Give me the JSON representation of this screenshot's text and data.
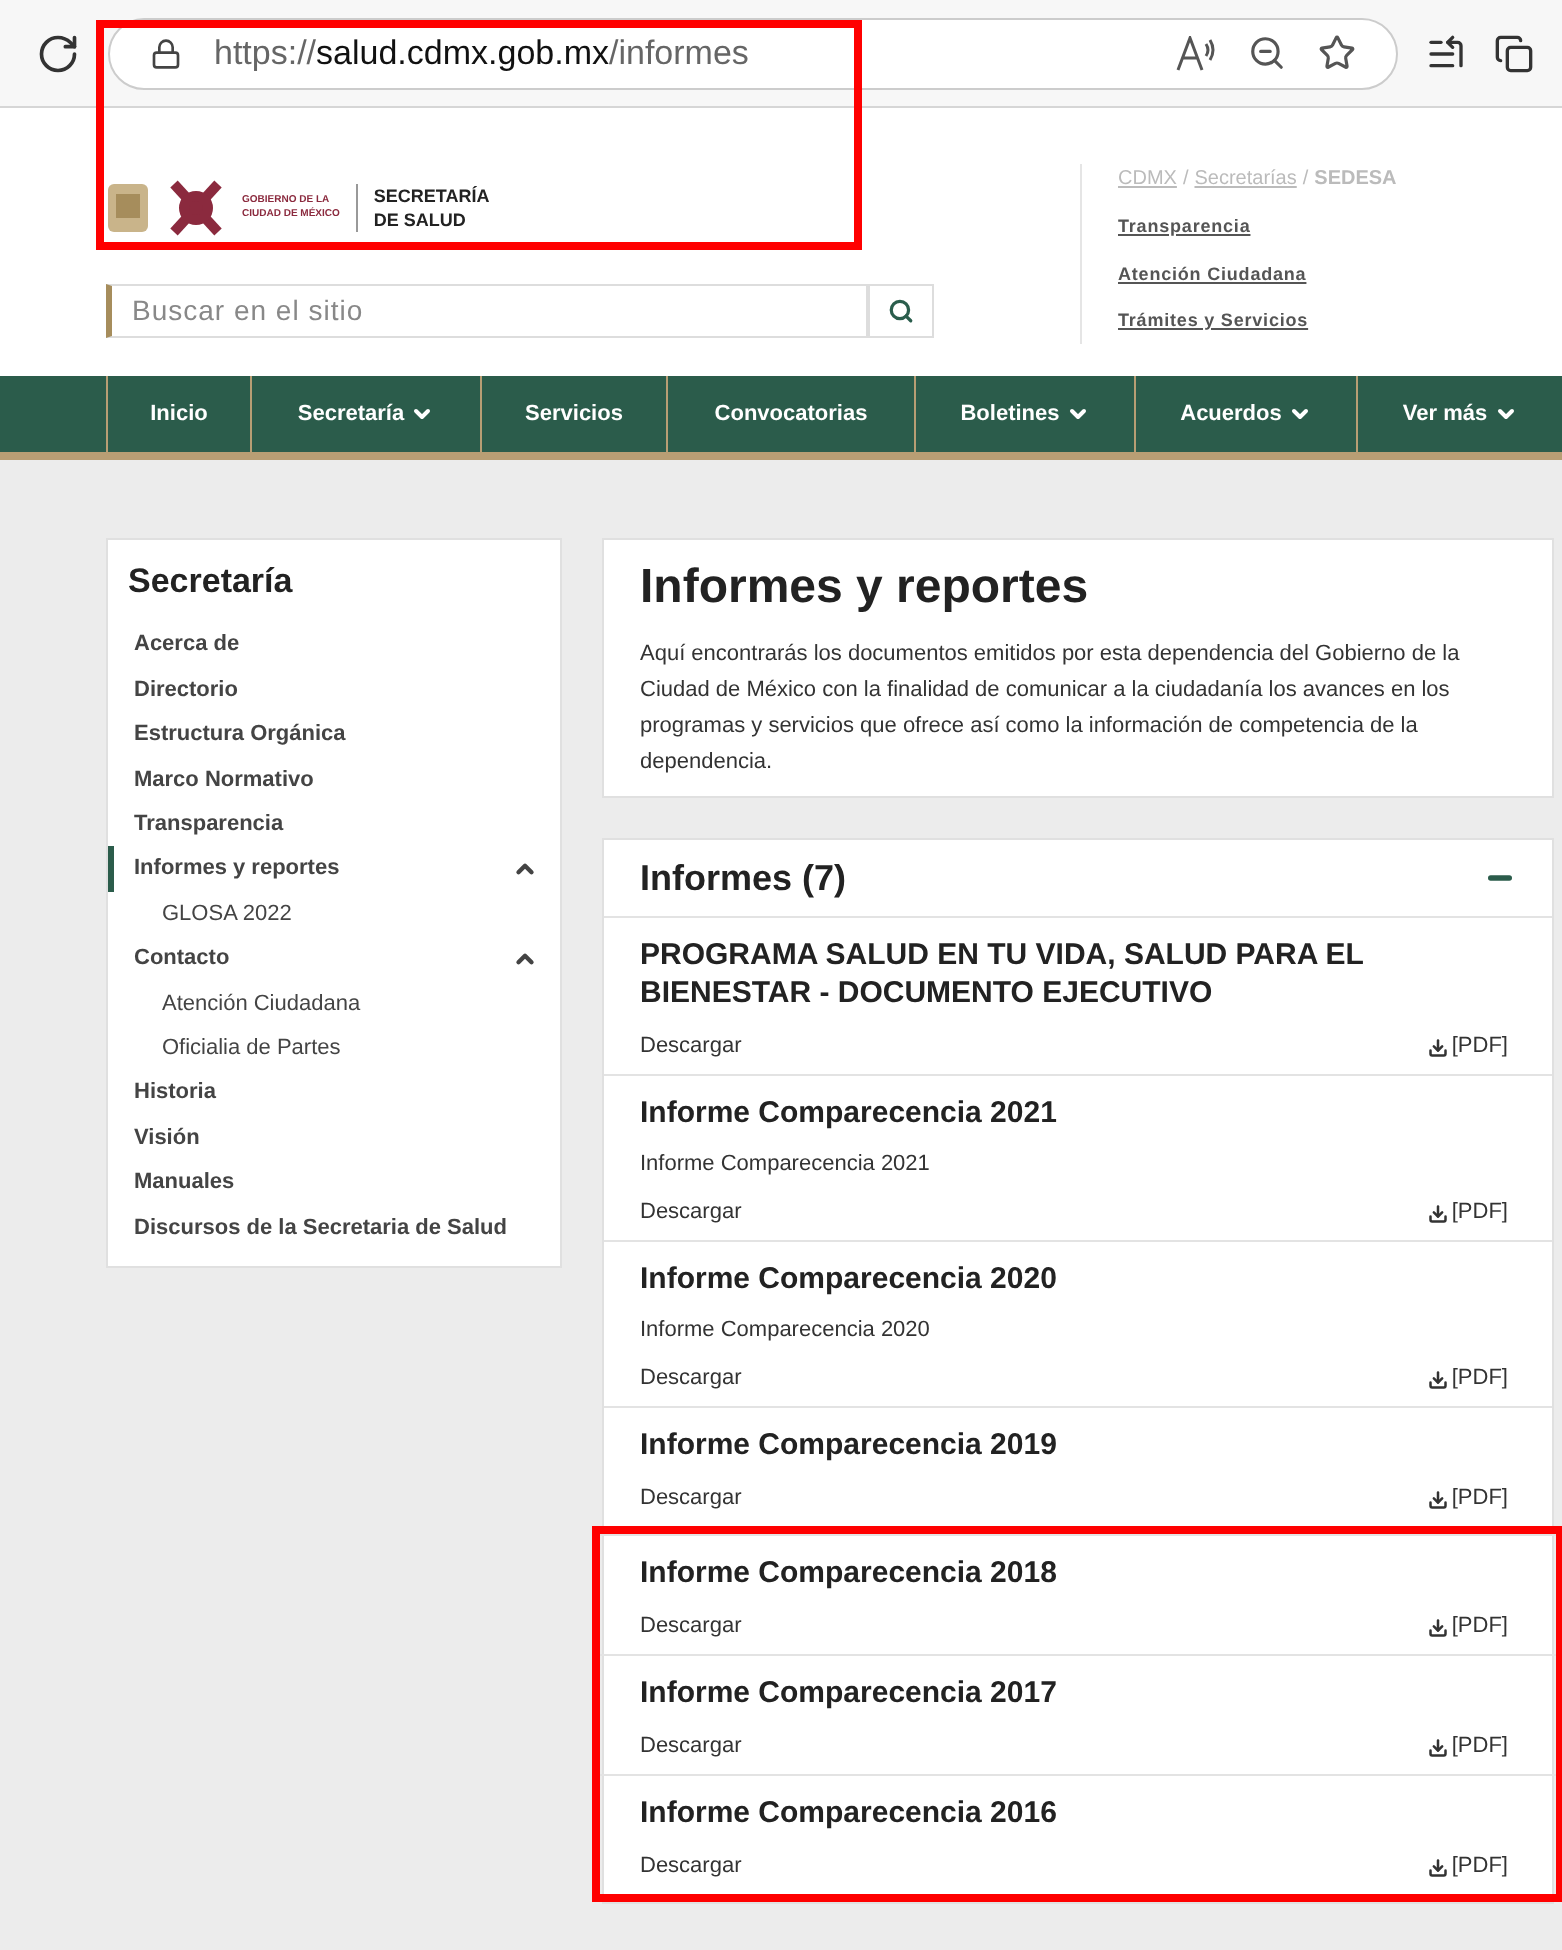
{
  "browser": {
    "url_scheme": "https://",
    "url_host": "salud.cdmx.gob.mx",
    "url_path": "/informes",
    "highlighted": true
  },
  "header": {
    "logo_small_text_1": "GOBIERNO DE LA",
    "logo_small_text_2": "CIUDAD DE MÉXICO",
    "logo_title_1": "SECRETARÍA",
    "logo_title_2": "DE SALUD",
    "search": {
      "placeholder": "Buscar en el sitio"
    },
    "breadcrumb_separator": "/",
    "breadcrumb": [
      {
        "label": "CDMX",
        "link": true
      },
      {
        "label": "Secretarías",
        "link": true
      },
      {
        "label": "SEDESA",
        "link": false
      }
    ],
    "links": [
      "Transparencia",
      "Atención Ciudadana",
      "Trámites y Servicios"
    ]
  },
  "nav": [
    {
      "label": "Inicio",
      "dropdown": false
    },
    {
      "label": "Secretaría",
      "dropdown": true
    },
    {
      "label": "Servicios",
      "dropdown": false
    },
    {
      "label": "Convocatorias",
      "dropdown": false
    },
    {
      "label": "Boletines",
      "dropdown": true
    },
    {
      "label": "Acuerdos",
      "dropdown": true
    },
    {
      "label": "Ver más",
      "dropdown": true
    }
  ],
  "sidebar": {
    "title": "Secretaría",
    "items": [
      {
        "label": "Acerca de",
        "selected": false
      },
      {
        "label": "Directorio",
        "selected": false
      },
      {
        "label": "Estructura Orgánica",
        "selected": false
      },
      {
        "label": "Marco Normativo",
        "selected": false
      },
      {
        "label": "Transparencia",
        "selected": false
      },
      {
        "label": "Informes y reportes",
        "selected": true,
        "expanded": true,
        "children": [
          {
            "label": "GLOSA 2022",
            "selected": false
          }
        ]
      },
      {
        "label": "Contacto",
        "selected": false,
        "expanded": true,
        "children": [
          {
            "label": "Atención Ciudadana",
            "selected": false
          },
          {
            "label": "Oficialia de Partes",
            "selected": false
          }
        ]
      },
      {
        "label": "Historia",
        "selected": false
      },
      {
        "label": "Visión",
        "selected": false
      },
      {
        "label": "Manuales",
        "selected": false
      },
      {
        "label": "Discursos de la Secretaria de Salud",
        "selected": false
      }
    ]
  },
  "intro": {
    "title": "Informes y reportes",
    "text": "Aquí encontrarás los documentos emitidos por esta dependencia del Gobierno de la Ciudad de México con la finalidad de comunicar a la ciudadanía los avances en los programas y servicios que ofrece así como la información de competencia de la dependencia."
  },
  "informes": {
    "title": "Informes (7)",
    "expanded": true,
    "items": [
      {
        "title": "PROGRAMA SALUD EN TU VIDA, SALUD PARA EL BIENESTAR - DOCUMENTO EJECUTIVO",
        "download": "Descargar",
        "format": "[PDF]",
        "highlighted": false
      },
      {
        "title": "Informe Comparecencia 2021",
        "description": "Informe Comparecencia 2021",
        "download": "Descargar",
        "format": "[PDF]",
        "highlighted": false
      },
      {
        "title": "Informe Comparecencia 2020",
        "description": "Informe Comparecencia 2020",
        "download": "Descargar",
        "format": "[PDF]",
        "highlighted": false
      },
      {
        "title": "Informe Comparecencia 2019",
        "download": "Descargar",
        "format": "[PDF]",
        "highlighted": false
      },
      {
        "title": "Informe Comparecencia 2018",
        "download": "Descargar",
        "format": "[PDF]",
        "highlighted": true
      },
      {
        "title": "Informe Comparecencia 2017",
        "download": "Descargar",
        "format": "[PDF]",
        "highlighted": true
      },
      {
        "title": "Informe Comparecencia 2016",
        "download": "Descargar",
        "format": "[PDF]",
        "highlighted": true
      }
    ]
  }
}
